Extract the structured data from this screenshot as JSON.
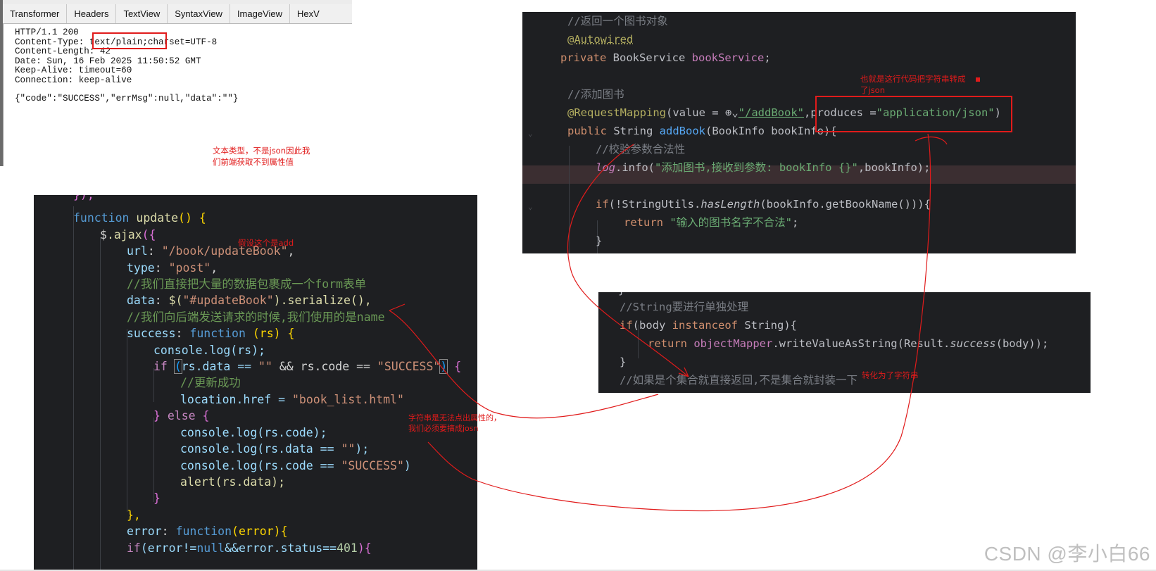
{
  "inspector": {
    "tabs": [
      "Transformer",
      "Headers",
      "TextView",
      "SyntaxView",
      "ImageView",
      "HexV"
    ],
    "raw_lines": [
      "HTTP/1.1 200",
      "Content-Type: text/plain;charset=UTF-8",
      "Content-Length: 42",
      "Date: Sun, 16 Feb 2025 11:50:52 GMT",
      "Keep-Alive: timeout=60",
      "Connection: keep-alive",
      "",
      "{\"code\":\"SUCCESS\",\"errMsg\":null,\"data\":\"\"}"
    ]
  },
  "annotations": {
    "text_type": "文本类型，不是json因此我们前端获取不到属性值",
    "assume_add": "假设这个是add",
    "this_line_json": "也就是这行代码把字符串转成了json",
    "to_string": "转化为了字符串",
    "string_no_props": "字符串是无法点出属性的，我们必须要搞成josn"
  },
  "js_code": {
    "l0": "});",
    "l1_kw": "function",
    "l1_fn": "update",
    "l1_rest": "() {",
    "l2_a": "$",
    "l2_b": ".ajax",
    "l2_c": "({",
    "l3_k": "url",
    "l3_v": "\"/book/updateBook\"",
    "l4_k": "type",
    "l4_v": "\"post\"",
    "l5": "//我们直接把大量的数据包裹成一个form表单",
    "l6_k": "data",
    "l6_v1": "$(",
    "l6_v2": "\"#updateBook\"",
    "l6_v3": ").serialize(),",
    "l7": "//我们向后端发送请求的时候,我们使用的是name",
    "l8_k": "success",
    "l8_kw": "function",
    "l8_rest": " (rs) {",
    "l9": "console.log(rs);",
    "l10_if": "if",
    "l10_a": "(",
    "l10_b": "rs.data == ",
    "l10_c": "\"\"",
    "l10_d": " && rs.code == ",
    "l10_e": "\"SUCCESS\"",
    "l10_f": ")",
    "l10_g": " {",
    "l11": "//更新成功",
    "l12_a": "location.href = ",
    "l12_b": "\"book_list.html\"",
    "l13_a": "} ",
    "l13_b": "else",
    "l13_c": " {",
    "l14": "console.log(rs.code);",
    "l15_a": "console.log(rs.data == ",
    "l15_b": "\"\"",
    "l15_c": ");",
    "l16_a": "console.log(rs.code == ",
    "l16_b": "\"SUCCESS\"",
    "l16_c": ")",
    "l17_a": "alert(rs.data);",
    "l18": "}",
    "l19": "},",
    "l20_k": "error",
    "l20_kw": "function",
    "l20_rest": "(error){",
    "l21_if": "if",
    "l21_rest": "(error!=",
    "l21_null": "null",
    "l21_rest2": "&&error.status==",
    "l21_num": "401",
    "l21_end": "){"
  },
  "java_top": {
    "c1": "//返回一个图书对象",
    "ann1": "@Autowired",
    "l3_kw": "private",
    "l3_type": " BookService ",
    "l3_fld": "bookService",
    "l3_end": ";",
    "c2": "//添加图书",
    "ann2": "@RequestMapping",
    "l6_a": "(value = ",
    "l6_globe": "⊕",
    "l6_url": "\"/addBook\"",
    "l6_b": ",produces =",
    "l6_str": "\"application/json\"",
    "l6_c": ")",
    "l7_kw": "public",
    "l7_type": " String ",
    "l7_fn": "addBook",
    "l7_rest": "(BookInfo bookInfo){",
    "c3": "//校验参数合法性",
    "l9_log": "log",
    "l9_a": ".info(",
    "l9_str": "\"添加图书,接收到参数: bookInfo {}\"",
    "l9_b": ",bookInfo);",
    "l11_kw": "if",
    "l11_a": "(!StringUtils.",
    "l11_fn": "hasLength",
    "l11_b": "(bookInfo.getBookName())){",
    "l12_kw": "return",
    "l12_str": "\"输入的图书名字不合法\"",
    "l12_end": ";",
    "l13": "}"
  },
  "java_bottom": {
    "l0": "}",
    "c1": "//String要进行单独处理",
    "l2_kw": "if",
    "l2_a": "(body ",
    "l2_kw2": "instanceof",
    "l2_b": " String){",
    "l3_kw": "return",
    "l3_fld": " objectMapper",
    "l3_a": ".writeValueAsString(Result.",
    "l3_it": "success",
    "l3_b": "(body));",
    "l4": "}",
    "c2": "//如果是个集合就直接返回,不是集合就封装一下"
  },
  "watermark": "CSDN @李小白66"
}
